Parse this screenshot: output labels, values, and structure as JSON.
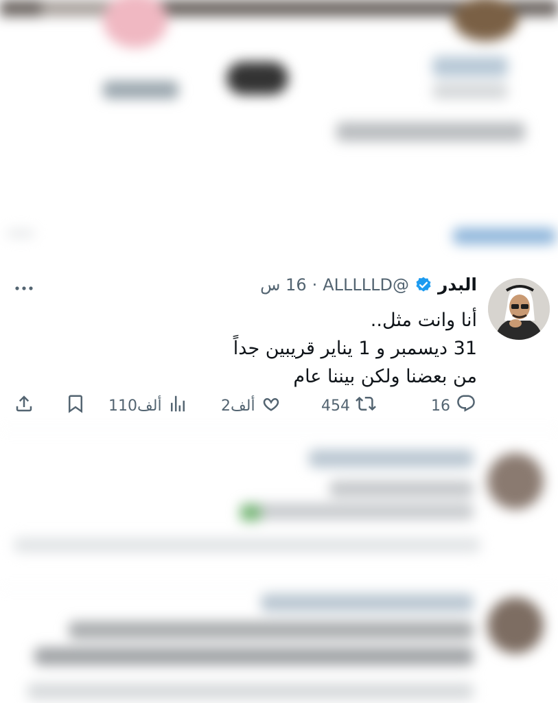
{
  "tweet": {
    "author_name": "البدر",
    "handle": "@ALLLLLD",
    "separator": "·",
    "time_ago": "16 س",
    "lines": [
      "أنا وانت مثل..",
      "31 ديسمبر و 1 يناير قريبين جداً",
      "من بعضنا ولكن بيننا عام"
    ],
    "actions": {
      "replies": "16",
      "retweets": "454",
      "likes": "2ألف",
      "views": "110ألف"
    }
  },
  "icons": {
    "verified": "verified-badge-icon",
    "more": "more-horizontal-icon",
    "reply": "reply-icon",
    "retweet": "retweet-icon",
    "like": "heart-icon",
    "views": "views-icon",
    "bookmark": "bookmark-icon",
    "share": "share-icon"
  },
  "colors": {
    "text": "#0f1419",
    "secondary": "#536471",
    "verified": "#1d9bf0"
  }
}
